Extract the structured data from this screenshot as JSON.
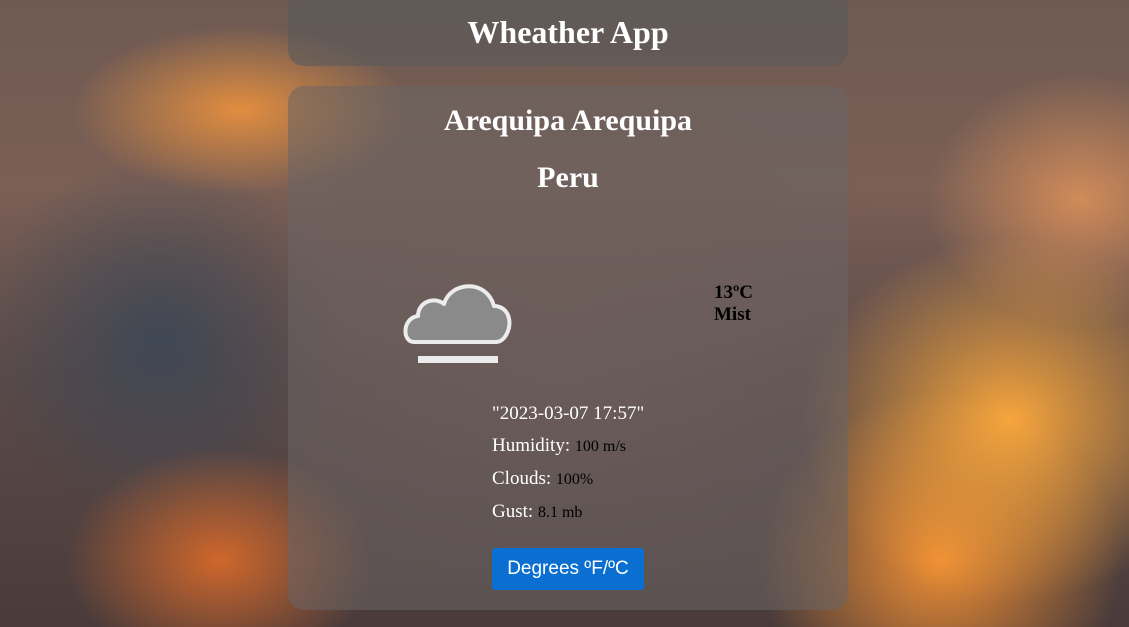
{
  "header": {
    "title": "Wheather App"
  },
  "location": {
    "city": "Arequipa Arequipa",
    "country": "Peru"
  },
  "current": {
    "icon": "fog-cloud-icon",
    "temperature": "13ºC",
    "condition": "Mist"
  },
  "details": {
    "datetime": "\"2023-03-07 17:57\"",
    "humidity_label": "Humidity:",
    "humidity_value": "100 m/s",
    "clouds_label": "Clouds:",
    "clouds_value": "100%",
    "gust_label": "Gust:",
    "gust_value": "8.1 mb"
  },
  "controls": {
    "toggle_units_label": "Degrees ºF/ºC"
  },
  "colors": {
    "button_bg": "#0a6fd0",
    "card_bg": "rgba(105,100,100,0.55)",
    "icon_gray": "#8a8a8a"
  }
}
